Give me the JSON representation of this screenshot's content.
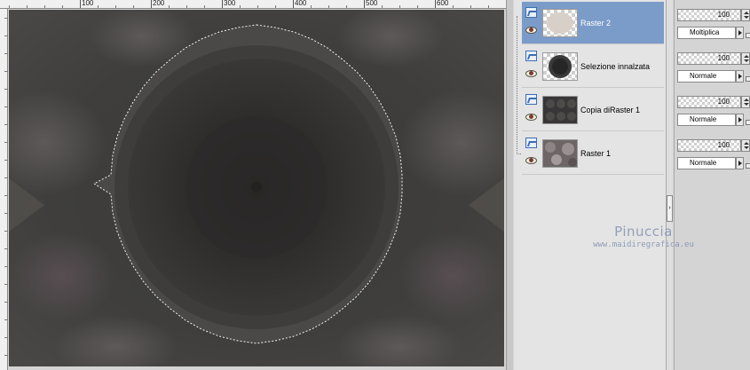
{
  "ruler": {
    "labels": [
      "100",
      "200",
      "300",
      "400",
      "500",
      "600"
    ]
  },
  "layers": [
    {
      "name": "Raster 2",
      "selected": true,
      "opacity": "100",
      "blend": "Moltiplica"
    },
    {
      "name": "Selezione innalzata",
      "selected": false,
      "opacity": "100",
      "blend": "Normale"
    },
    {
      "name": "Copia diRaster 1",
      "selected": false,
      "opacity": "100",
      "blend": "Normale"
    },
    {
      "name": "Raster 1",
      "selected": false,
      "opacity": "100",
      "blend": "Normale"
    }
  ],
  "watermark": {
    "name": "Pinuccia",
    "url": "www.maidiregrafica.eu"
  },
  "colors": {
    "selected_layer": "#7b9bc9",
    "canvas_dark": "#2e2d2c",
    "canvas_ring": "#4d4b4a",
    "watermark": "#7d8fb0"
  }
}
